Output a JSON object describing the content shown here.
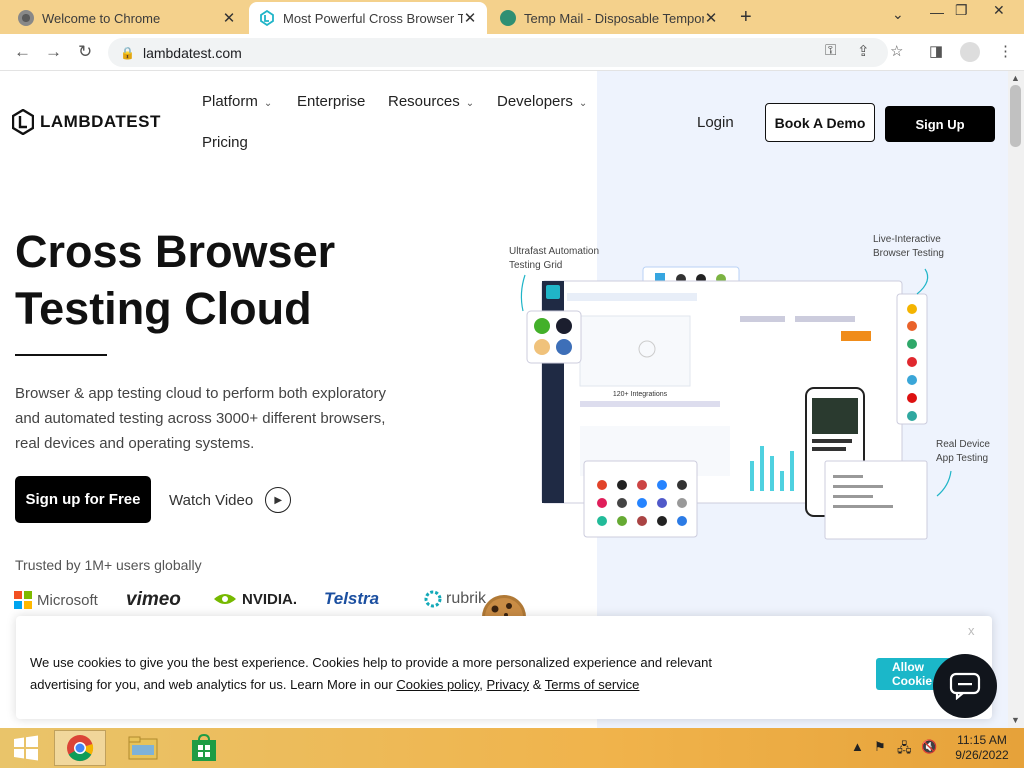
{
  "browser": {
    "tabs": [
      {
        "title": "Welcome to Chrome",
        "active": false
      },
      {
        "title": "Most Powerful Cross Browser Tes",
        "active": true
      },
      {
        "title": "Temp Mail - Disposable Tempora",
        "active": false
      }
    ],
    "url": "lambdatest.com"
  },
  "site": {
    "logo_text": "LAMBDATEST",
    "nav": {
      "platform": "Platform",
      "enterprise": "Enterprise",
      "resources": "Resources",
      "developers": "Developers",
      "pricing": "Pricing"
    },
    "login": "Login",
    "book_demo": "Book A Demo",
    "sign_up": "Sign Up"
  },
  "hero": {
    "title_line1": "Cross Browser",
    "title_line2": "Testing Cloud",
    "desc_line1": "Browser & app testing cloud to perform both exploratory",
    "desc_line2": "and automated testing across 3000+ different browsers,",
    "desc_line3": "real devices and operating systems.",
    "cta": "Sign up for Free",
    "watch": "Watch Video",
    "trusted": "Trusted by 1M+ users globally"
  },
  "brands": [
    "Microsoft",
    "vimeo",
    "NVIDIA.",
    "Telstra",
    "rubrik"
  ],
  "illustration": {
    "grid_label_1": "Ultrafast Automation",
    "grid_label_2": "Testing Grid",
    "live_label_1": "Live-Interactive",
    "live_label_2": "Browser Testing",
    "device_label_1": "Real Device",
    "device_label_2": "App Testing",
    "integrations": "120+ Integrations",
    "cy": "cy",
    "se": "Se"
  },
  "cookie": {
    "line1": "We use cookies to give you the best experience. Cookies help to provide a more personalized experience and relevant",
    "line2_prefix": "advertising for you, and web analytics for us. Learn More in our ",
    "cookies_policy": "Cookies policy",
    "comma": ", ",
    "privacy": "Privacy",
    "amp": " & ",
    "terms": "Terms of service",
    "allow": "Allow Cookie",
    "close": "x"
  },
  "taskbar": {
    "time": "11:15 AM",
    "date": "9/26/2022"
  },
  "colors": {
    "tabbar": "#f4d18c",
    "accent_teal": "#1bb7c9",
    "hero_bg_right": "#eef3fd"
  }
}
